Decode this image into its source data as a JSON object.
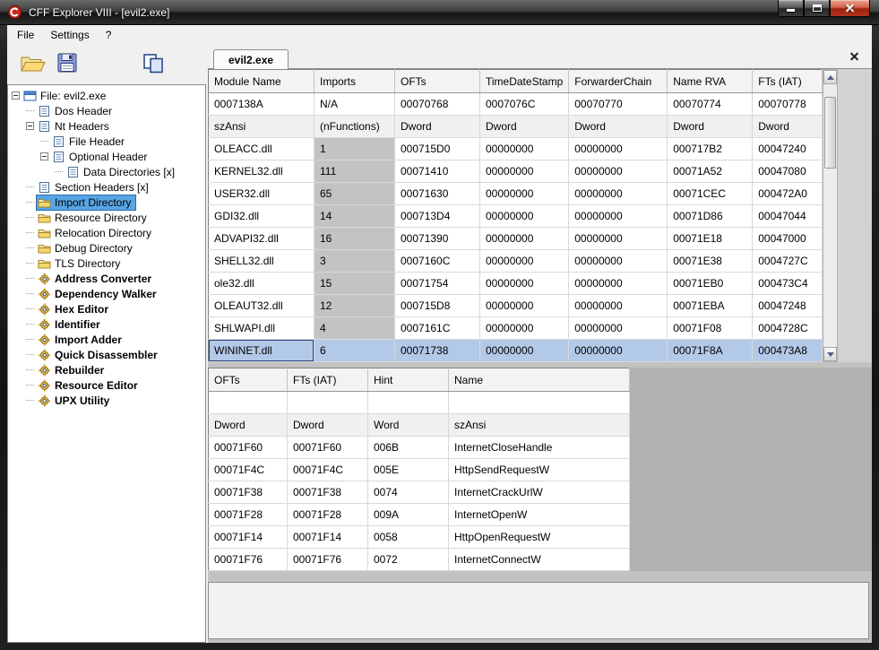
{
  "window": {
    "title": "CFF Explorer VIII - [evil2.exe]"
  },
  "menu": {
    "items": [
      "File",
      "Settings",
      "?"
    ]
  },
  "toolbar": {
    "buttons": [
      {
        "id": "open-file",
        "icon": "open-folder-icon"
      },
      {
        "id": "save-file",
        "icon": "save-icon"
      },
      {
        "id": "compare",
        "icon": "pages-icon"
      }
    ]
  },
  "tab": {
    "label": "evil2.exe"
  },
  "tree": {
    "items": [
      {
        "label": "File: evil2.exe",
        "depth": 0,
        "expander": true,
        "icon": "file",
        "bold": false,
        "selected": false
      },
      {
        "label": "Dos Header",
        "depth": 1,
        "expander": false,
        "icon": "header",
        "bold": false,
        "selected": false
      },
      {
        "label": "Nt Headers",
        "depth": 1,
        "expander": true,
        "icon": "header",
        "bold": false,
        "selected": false
      },
      {
        "label": "File Header",
        "depth": 2,
        "expander": false,
        "icon": "header",
        "bold": false,
        "selected": false
      },
      {
        "label": "Optional Header",
        "depth": 2,
        "expander": true,
        "icon": "header",
        "bold": false,
        "selected": false
      },
      {
        "label": "Data Directories [x]",
        "depth": 3,
        "expander": false,
        "icon": "header",
        "bold": false,
        "selected": false
      },
      {
        "label": "Section Headers [x]",
        "depth": 1,
        "expander": false,
        "icon": "header",
        "bold": false,
        "selected": false
      },
      {
        "label": "Import Directory",
        "depth": 1,
        "expander": false,
        "icon": "folder",
        "bold": false,
        "selected": true
      },
      {
        "label": "Resource Directory",
        "depth": 1,
        "expander": false,
        "icon": "folder",
        "bold": false,
        "selected": false
      },
      {
        "label": "Relocation Directory",
        "depth": 1,
        "expander": false,
        "icon": "folder",
        "bold": false,
        "selected": false
      },
      {
        "label": "Debug Directory",
        "depth": 1,
        "expander": false,
        "icon": "folder",
        "bold": false,
        "selected": false
      },
      {
        "label": "TLS Directory",
        "depth": 1,
        "expander": false,
        "icon": "folder",
        "bold": false,
        "selected": false
      },
      {
        "label": "Address Converter",
        "depth": 1,
        "expander": false,
        "icon": "tool",
        "bold": true,
        "selected": false
      },
      {
        "label": "Dependency Walker",
        "depth": 1,
        "expander": false,
        "icon": "tool",
        "bold": true,
        "selected": false
      },
      {
        "label": "Hex Editor",
        "depth": 1,
        "expander": false,
        "icon": "tool",
        "bold": true,
        "selected": false
      },
      {
        "label": "Identifier",
        "depth": 1,
        "expander": false,
        "icon": "tool",
        "bold": true,
        "selected": false
      },
      {
        "label": "Import Adder",
        "depth": 1,
        "expander": false,
        "icon": "tool",
        "bold": true,
        "selected": false
      },
      {
        "label": "Quick Disassembler",
        "depth": 1,
        "expander": false,
        "icon": "tool",
        "bold": true,
        "selected": false
      },
      {
        "label": "Rebuilder",
        "depth": 1,
        "expander": false,
        "icon": "tool",
        "bold": true,
        "selected": false
      },
      {
        "label": "Resource Editor",
        "depth": 1,
        "expander": false,
        "icon": "tool",
        "bold": true,
        "selected": false
      },
      {
        "label": "UPX Utility",
        "depth": 1,
        "expander": false,
        "icon": "tool",
        "bold": true,
        "selected": false
      }
    ]
  },
  "imports_table": {
    "columns": [
      "Module Name",
      "Imports",
      "OFTs",
      "TimeDateStamp",
      "ForwarderChain",
      "Name RVA",
      "FTs (IAT)"
    ],
    "offsets_row": [
      "0007138A",
      "N/A",
      "00070768",
      "0007076C",
      "00070770",
      "00070774",
      "00070778"
    ],
    "types_row": [
      "szAnsi",
      "(nFunctions)",
      "Dword",
      "Dword",
      "Dword",
      "Dword",
      "Dword"
    ],
    "rows": [
      [
        "OLEACC.dll",
        "1",
        "000715D0",
        "00000000",
        "00000000",
        "000717B2",
        "00047240"
      ],
      [
        "KERNEL32.dll",
        "111",
        "00071410",
        "00000000",
        "00000000",
        "00071A52",
        "00047080"
      ],
      [
        "USER32.dll",
        "65",
        "00071630",
        "00000000",
        "00000000",
        "00071CEC",
        "000472A0"
      ],
      [
        "GDI32.dll",
        "14",
        "000713D4",
        "00000000",
        "00000000",
        "00071D86",
        "00047044"
      ],
      [
        "ADVAPI32.dll",
        "16",
        "00071390",
        "00000000",
        "00000000",
        "00071E18",
        "00047000"
      ],
      [
        "SHELL32.dll",
        "3",
        "0007160C",
        "00000000",
        "00000000",
        "00071E38",
        "0004727C"
      ],
      [
        "ole32.dll",
        "15",
        "00071754",
        "00000000",
        "00000000",
        "00071EB0",
        "000473C4"
      ],
      [
        "OLEAUT32.dll",
        "12",
        "000715D8",
        "00000000",
        "00000000",
        "00071EBA",
        "00047248"
      ],
      [
        "SHLWAPI.dll",
        "4",
        "0007161C",
        "00000000",
        "00000000",
        "00071F08",
        "0004728C"
      ],
      [
        "WININET.dll",
        "6",
        "00071738",
        "00000000",
        "00000000",
        "00071F8A",
        "000473A8"
      ]
    ],
    "selected_module": "WININET.dll"
  },
  "functions_table": {
    "columns": [
      "OFTs",
      "FTs (IAT)",
      "Hint",
      "Name"
    ],
    "offsets_row": [
      "",
      "",
      "",
      ""
    ],
    "types_row": [
      "Dword",
      "Dword",
      "Word",
      "szAnsi"
    ],
    "rows": [
      [
        "00071F60",
        "00071F60",
        "006B",
        "InternetCloseHandle"
      ],
      [
        "00071F4C",
        "00071F4C",
        "005E",
        "HttpSendRequestW"
      ],
      [
        "00071F38",
        "00071F38",
        "0074",
        "InternetCrackUrlW"
      ],
      [
        "00071F28",
        "00071F28",
        "009A",
        "InternetOpenW"
      ],
      [
        "00071F14",
        "00071F14",
        "0058",
        "HttpOpenRequestW"
      ],
      [
        "00071F76",
        "00071F76",
        "0072",
        "InternetConnectW"
      ]
    ]
  },
  "colors": {
    "selected_row": "#b3c9e8",
    "tree_selection": "#57a5e5",
    "imports_column_gray": "#c3c3c3",
    "close_button_red": "#b5341f",
    "close_button_red_light": "#eda393"
  }
}
